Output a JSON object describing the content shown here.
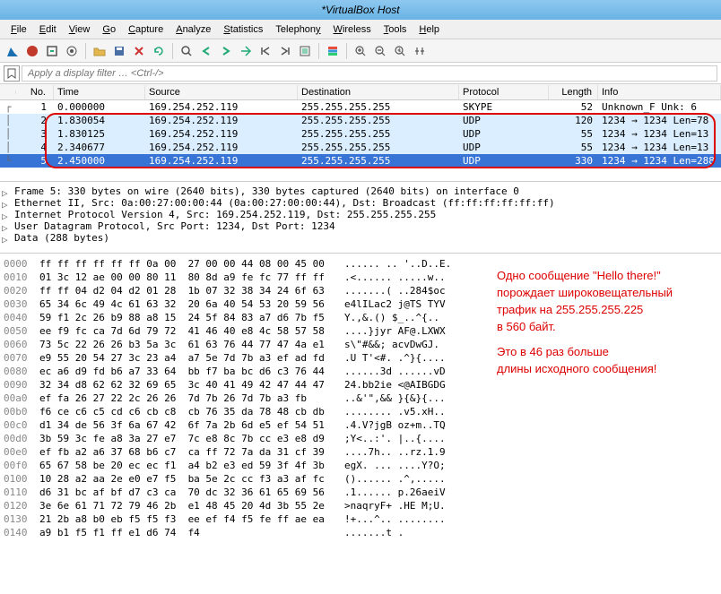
{
  "title": "*VirtualBox Host",
  "menu": [
    "File",
    "Edit",
    "View",
    "Go",
    "Capture",
    "Analyze",
    "Statistics",
    "Telephony",
    "Wireless",
    "Tools",
    "Help"
  ],
  "filter_placeholder": "Apply a display filter … <Ctrl-/>",
  "columns": [
    "No.",
    "Time",
    "Source",
    "Destination",
    "Protocol",
    "Length",
    "Info"
  ],
  "packets": [
    {
      "no": "1",
      "time": "0.000000",
      "src": "169.254.252.119",
      "dst": "255.255.255.255",
      "proto": "SKYPE",
      "len": "52",
      "info": "Unknown_F  Unk: 6"
    },
    {
      "no": "2",
      "time": "1.830054",
      "src": "169.254.252.119",
      "dst": "255.255.255.255",
      "proto": "UDP",
      "len": "120",
      "info": "1234 → 1234 Len=78"
    },
    {
      "no": "3",
      "time": "1.830125",
      "src": "169.254.252.119",
      "dst": "255.255.255.255",
      "proto": "UDP",
      "len": "55",
      "info": "1234 → 1234 Len=13"
    },
    {
      "no": "4",
      "time": "2.340677",
      "src": "169.254.252.119",
      "dst": "255.255.255.255",
      "proto": "UDP",
      "len": "55",
      "info": "1234 → 1234 Len=13"
    },
    {
      "no": "5",
      "time": "2.450000",
      "src": "169.254.252.119",
      "dst": "255.255.255.255",
      "proto": "UDP",
      "len": "330",
      "info": "1234 → 1234 Len=288"
    }
  ],
  "details": [
    "Frame 5: 330 bytes on wire (2640 bits), 330 bytes captured (2640 bits) on interface 0",
    "Ethernet II, Src: 0a:00:27:00:00:44 (0a:00:27:00:00:44), Dst: Broadcast (ff:ff:ff:ff:ff:ff)",
    "Internet Protocol Version 4, Src: 169.254.252.119, Dst: 255.255.255.255",
    "User Datagram Protocol, Src Port: 1234, Dst Port: 1234",
    "Data (288 bytes)"
  ],
  "hex": [
    {
      "o": "0000",
      "b": "ff ff ff ff ff ff 0a 00  27 00 00 44 08 00 45 00",
      "a": "...... .. '..D..E."
    },
    {
      "o": "0010",
      "b": "01 3c 12 ae 00 00 80 11  80 8d a9 fe fc 77 ff ff",
      "a": ".<...... .....w.."
    },
    {
      "o": "0020",
      "b": "ff ff 04 d2 04 d2 01 28  1b 07 32 38 34 24 6f 63",
      "a": ".......( ..284$oc"
    },
    {
      "o": "0030",
      "b": "65 34 6c 49 4c 61 63 32  20 6a 40 54 53 20 59 56",
      "a": "e4lILac2 j@TS TYV"
    },
    {
      "o": "0040",
      "b": "59 f1 2c 26 b9 88 a8 15  24 5f 84 83 a7 d6 7b f5",
      "a": "Y.,&.() $_..^{.."
    },
    {
      "o": "0050",
      "b": "ee f9 fc ca 7d 6d 79 72  41 46 40 e8 4c 58 57 58",
      "a": "....}jyr AF@.LXWX"
    },
    {
      "o": "0060",
      "b": "73 5c 22 26 26 b3 5a 3c  61 63 76 44 77 47 4a e1",
      "a": "s\\\"#&&; acvDwGJ."
    },
    {
      "o": "0070",
      "b": "e9 55 20 54 27 3c 23 a4  a7 5e 7d 7b a3 ef ad fd",
      "a": ".U T'<#. .^}{...."
    },
    {
      "o": "0080",
      "b": "ec a6 d9 fd b6 a7 33 64  bb f7 ba bc d6 c3 76 44",
      "a": "......3d ......vD"
    },
    {
      "o": "0090",
      "b": "32 34 d8 62 62 32 69 65  3c 40 41 49 42 47 44 47",
      "a": "24.bb2ie <@AIBGDG"
    },
    {
      "o": "00a0",
      "b": "ef fa 26 27 22 2c 26 26  7d 7b 26 7d 7b a3 fb    ",
      "a": "..&'\",&& }{&}{...  "
    },
    {
      "o": "00b0",
      "b": "f6 ce c6 c5 cd c6 cb c8  cb 76 35 da 78 48 cb db",
      "a": "........ .v5.xH.."
    },
    {
      "o": "00c0",
      "b": "d1 34 de 56 3f 6a 67 42  6f 7a 2b 6d e5 ef 54 51",
      "a": ".4.V?jgB oz+m..TQ"
    },
    {
      "o": "00d0",
      "b": "3b 59 3c fe a8 3a 27 e7  7c e8 8c 7b cc e3 e8 d9",
      "a": ";Y<..:'. |..{...."
    },
    {
      "o": "00e0",
      "b": "ef fb a2 a6 37 68 b6 c7  ca ff 72 7a da 31 cf 39",
      "a": "....7h.. ..rz.1.9"
    },
    {
      "o": "00f0",
      "b": "65 67 58 be 20 ec ec f1  a4 b2 e3 ed 59 3f 4f 3b",
      "a": "egX. ... ....Y?O;"
    },
    {
      "o": "0100",
      "b": "10 28 a2 aa 2e e0 e7 f5  ba 5e 2c cc f3 a3 af fc",
      "a": "()...... .^,....."
    },
    {
      "o": "0110",
      "b": "d6 31 bc af bf d7 c3 ca  70 dc 32 36 61 65 69 56",
      "a": ".1...... p.26aeiV"
    },
    {
      "o": "0120",
      "b": "3e 6e 61 71 72 79 46 2b  e1 48 45 20 4d 3b 55 2e",
      "a": ">naqryF+ .HE M;U."
    },
    {
      "o": "0130",
      "b": "21 2b a8 b0 eb f5 f5 f3  ee ef f4 f5 fe ff ae ea",
      "a": "!+...^.. ........"
    },
    {
      "o": "0140",
      "b": "a9 b1 f5 f1 ff e1 d6 74  f4                       ",
      "a": ".......t ."
    }
  ],
  "annotation": {
    "p1": "Одно сообщение \"Hello there!\"",
    "p2": "порождает широковещательный",
    "p3": "трафик на 255.255.255.225",
    "p4": "в 560 байт.",
    "p5": "Это в 46 раз больше",
    "p6": "длины исходного сообщения!"
  }
}
